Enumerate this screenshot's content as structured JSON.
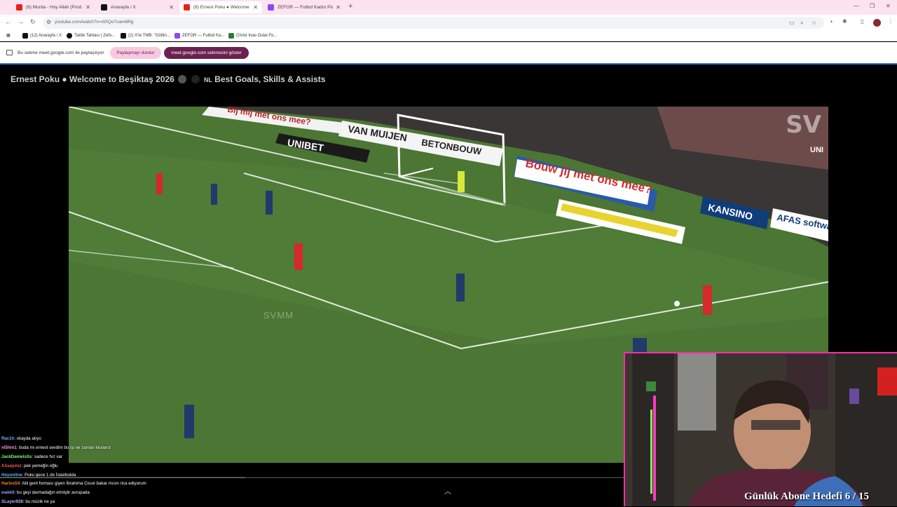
{
  "browser": {
    "tabs": [
      {
        "title": "(6) Murda - Hoy Allah (Prod. M...",
        "color": "#e62117"
      },
      {
        "title": "Anarayfa / X",
        "color": "#111111"
      },
      {
        "title": "(8) Ernest Poku ● Welcome ...",
        "color": "#e62117"
      },
      {
        "title": "ZEFOR — Futbol Kadro Planlam...",
        "color": "#8a4af3"
      }
    ],
    "url": "youtube.com/watch?v=ARQo7oam6Rg",
    "bookmarks": [
      {
        "label": "(12) Anarayfa / X",
        "color": "#111111"
      },
      {
        "label": "Taktik Tahtası | Zefo...",
        "color": "#111111"
      },
      {
        "label": "(2) X'te TMB: \"Göttin...",
        "color": "#111111"
      },
      {
        "label": "ZEFOR — Futbol Ka...",
        "color": "#8a4af3"
      },
      {
        "label": "Christ Inao Oulai Fo...",
        "color": "#2f7d2f"
      }
    ]
  },
  "sharebar": {
    "text": "Bu sekme meet.google.com ile paylaşılıyor",
    "stop_label": "Paylaşmayı durdur",
    "show_label": "meet.google.com sekmesini göster"
  },
  "video": {
    "title_prefix": "Ernest Poku ● Welcome to Beşiktaş 2026",
    "title_flag": "NL",
    "title_suffix": "Best Goals, Skills & Assists",
    "watermark_top": "SV",
    "watermark_mid": "SVMM",
    "ads": [
      "Bij mij met ons mee?",
      "UNIBET",
      "VAN MUIJEN",
      "BETONBOUW",
      "Bouw jij met ons mee?",
      "KANSINO",
      "AFAS software",
      "UNI"
    ]
  },
  "chat": [
    {
      "user": "ffac1h",
      "msg": ": okayda atıyo",
      "color": "#6ab3ff"
    },
    {
      "user": "nl5hin1",
      "msg": ": buda mı ernest sevdim bu işi ne zaman kiralarız",
      "color": "#ff9bd4"
    },
    {
      "user": "JackDanielsSs",
      "msg": ": sadece hız var",
      "color": "#7bff7b"
    },
    {
      "user": "A1sayınız",
      "msg": ": pek yemeğin oğlu",
      "color": "#ff5b5b"
    },
    {
      "user": "Heyonline",
      "msg": ": Poku gece 1 de İstanbulda",
      "color": "#5bb0ff"
    },
    {
      "user": "Harlos54",
      "msg": ": Abi gent forması giyen İbrahima Cissé bakar mısın rica ediyorum",
      "color": "#ff7b2b"
    },
    {
      "user": "wakk0",
      "msg": ": bu geyi darmadağın etmiştir avrupada",
      "color": "#9b9bff"
    },
    {
      "user": "SLayer928",
      "msg": ": bu müzik ne ya",
      "color": "#b0b0ff"
    }
  ],
  "overlay": {
    "goal_text": "Günlük Abone Hedefi 6 / 15",
    "subscribers_current": 6,
    "subscribers_goal": 15
  },
  "colors": {
    "tabstrip": "#fbe3ef",
    "stop_pill": "#f7c9e0",
    "show_pill": "#6b2150",
    "accent_border": "#ff2bb0"
  }
}
